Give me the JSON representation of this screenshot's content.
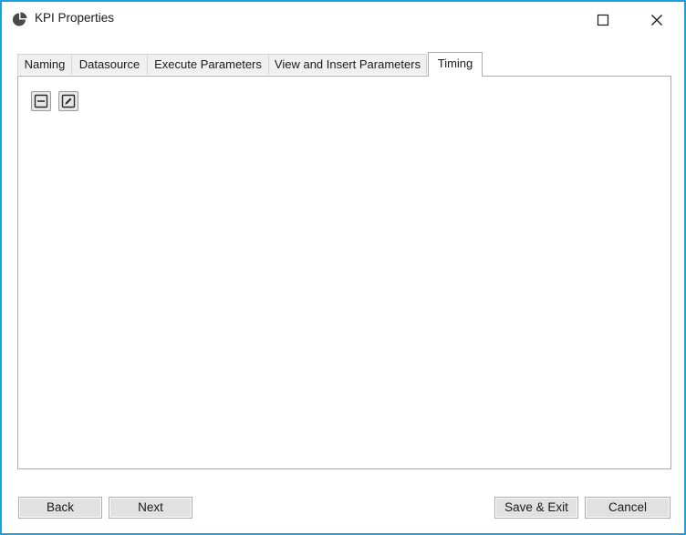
{
  "window": {
    "title": "KPI Properties",
    "accent_color": "#1da1dc",
    "app_icon": "pie-chart-icon",
    "controls": {
      "maximize_icon": "maximize-icon",
      "close_icon": "close-icon"
    }
  },
  "tabs": [
    {
      "label": "Naming",
      "active": false
    },
    {
      "label": "Datasource",
      "active": false
    },
    {
      "label": "Execute Parameters",
      "active": false
    },
    {
      "label": "View and Insert Parameters",
      "active": false
    },
    {
      "label": "Timing",
      "active": true
    }
  ],
  "toolbar": {
    "buttons": [
      {
        "icon": "collapse-icon"
      },
      {
        "icon": "edit-icon"
      }
    ]
  },
  "footer": {
    "back_label": "Back",
    "next_label": "Next",
    "save_exit_label": "Save & Exit",
    "cancel_label": "Cancel"
  }
}
